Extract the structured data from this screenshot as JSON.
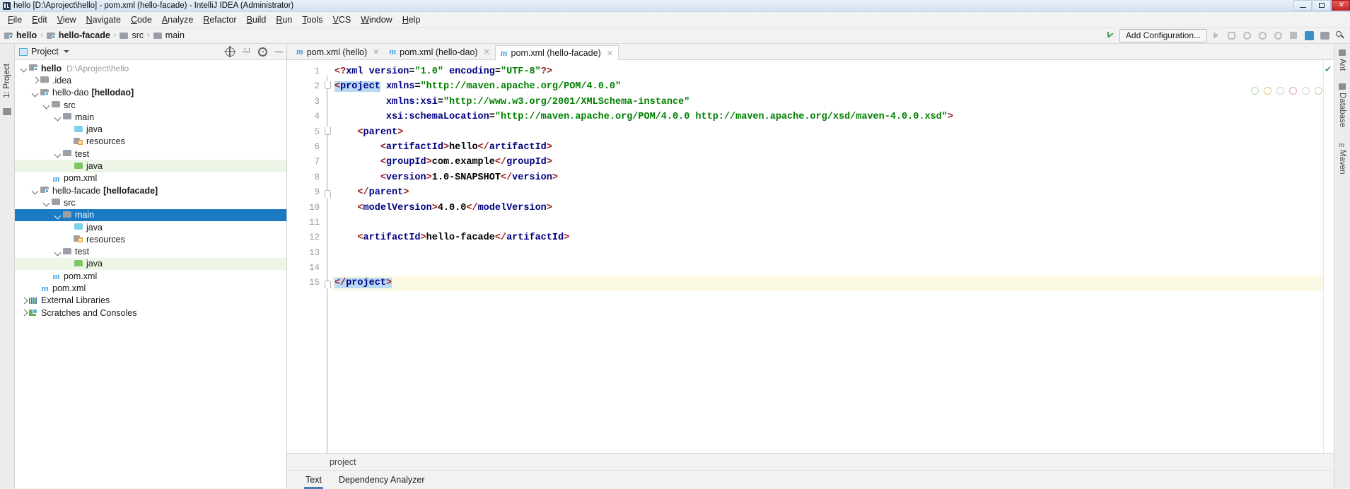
{
  "window": {
    "title": "hello [D:\\Aproject\\hello] - pom.xml (hello-facade) - IntelliJ IDEA (Administrator)",
    "minimize": "–",
    "maximize": "□",
    "close": "✕"
  },
  "menubar": {
    "items": [
      "File",
      "Edit",
      "View",
      "Navigate",
      "Code",
      "Analyze",
      "Refactor",
      "Build",
      "Run",
      "Tools",
      "VCS",
      "Window",
      "Help"
    ]
  },
  "breadcrumb": {
    "separator": "›",
    "items": [
      {
        "label": "hello",
        "icon": "module-icon",
        "bold": true
      },
      {
        "label": "hello-facade",
        "icon": "module-icon",
        "bold": true
      },
      {
        "label": "src",
        "icon": "folder-icon",
        "bold": false
      },
      {
        "label": "main",
        "icon": "folder-icon",
        "bold": false
      }
    ]
  },
  "toolbar": {
    "add_configuration": "Add Configuration...",
    "icons": [
      "back-arrow-icon",
      "run-icon",
      "debug-icon",
      "run-coverage-icon",
      "profile-icon",
      "stop-icon",
      "search-everywhere-icon",
      "layout-icon",
      "settings-icon"
    ]
  },
  "project_panel": {
    "title": "Project",
    "header_icons": [
      "locate-icon",
      "expand-collapse-icon",
      "gear-icon",
      "hide-icon"
    ],
    "left_tab": "1: Project",
    "tree": [
      {
        "indent": 0,
        "arrow": "open",
        "icon": "module-icon",
        "label": "hello",
        "bold": true,
        "sub": "D:\\Aproject\\hello",
        "state": "normal"
      },
      {
        "indent": 1,
        "arrow": "closed",
        "icon": "folder-icon",
        "label": ".idea",
        "bold": false,
        "sub": "",
        "state": "normal"
      },
      {
        "indent": 1,
        "arrow": "open",
        "icon": "module-icon",
        "label": "hello-dao",
        "bold": false,
        "sub": "",
        "bracket": "[hellodao]",
        "state": "normal"
      },
      {
        "indent": 2,
        "arrow": "open",
        "icon": "folder-icon",
        "label": "src",
        "bold": false,
        "sub": "",
        "state": "normal"
      },
      {
        "indent": 3,
        "arrow": "open",
        "icon": "folder-icon",
        "label": "main",
        "bold": false,
        "sub": "",
        "state": "normal"
      },
      {
        "indent": 4,
        "arrow": "none",
        "icon": "source-folder-icon",
        "label": "java",
        "bold": false,
        "sub": "",
        "state": "normal"
      },
      {
        "indent": 4,
        "arrow": "none",
        "icon": "resources-folder-icon",
        "label": "resources",
        "bold": false,
        "sub": "",
        "state": "normal"
      },
      {
        "indent": 3,
        "arrow": "open",
        "icon": "folder-icon",
        "label": "test",
        "bold": false,
        "sub": "",
        "state": "normal"
      },
      {
        "indent": 4,
        "arrow": "none",
        "icon": "test-folder-icon",
        "label": "java",
        "bold": false,
        "sub": "",
        "state": "green"
      },
      {
        "indent": 2,
        "arrow": "none",
        "icon": "maven-icon",
        "label": "pom.xml",
        "bold": false,
        "sub": "",
        "state": "normal"
      },
      {
        "indent": 1,
        "arrow": "open",
        "icon": "module-icon",
        "label": "hello-facade",
        "bold": false,
        "sub": "",
        "bracket": "[hellofacade]",
        "state": "normal"
      },
      {
        "indent": 2,
        "arrow": "open",
        "icon": "folder-icon",
        "label": "src",
        "bold": false,
        "sub": "",
        "state": "normal"
      },
      {
        "indent": 3,
        "arrow": "open",
        "icon": "folder-icon",
        "label": "main",
        "bold": false,
        "sub": "",
        "state": "selected"
      },
      {
        "indent": 4,
        "arrow": "none",
        "icon": "source-folder-icon",
        "label": "java",
        "bold": false,
        "sub": "",
        "state": "normal"
      },
      {
        "indent": 4,
        "arrow": "none",
        "icon": "resources-folder-icon",
        "label": "resources",
        "bold": false,
        "sub": "",
        "state": "normal"
      },
      {
        "indent": 3,
        "arrow": "open",
        "icon": "folder-icon",
        "label": "test",
        "bold": false,
        "sub": "",
        "state": "normal"
      },
      {
        "indent": 4,
        "arrow": "none",
        "icon": "test-folder-icon",
        "label": "java",
        "bold": false,
        "sub": "",
        "state": "green"
      },
      {
        "indent": 2,
        "arrow": "none",
        "icon": "maven-icon",
        "label": "pom.xml",
        "bold": false,
        "sub": "",
        "state": "normal"
      },
      {
        "indent": 1,
        "arrow": "none",
        "icon": "maven-icon",
        "label": "pom.xml",
        "bold": false,
        "sub": "",
        "state": "normal"
      },
      {
        "indent": 0,
        "arrow": "closed",
        "icon": "external-libraries-icon",
        "label": "External Libraries",
        "bold": false,
        "sub": "",
        "state": "normal"
      },
      {
        "indent": 0,
        "arrow": "closed",
        "icon": "scratches-icon",
        "label": "Scratches and Consoles",
        "bold": false,
        "sub": "",
        "state": "normal"
      }
    ]
  },
  "editor": {
    "tabs": [
      {
        "label": "pom.xml (hello)",
        "active": false,
        "close": "✕"
      },
      {
        "label": "pom.xml (hello-dao)",
        "active": false,
        "close": "✕"
      },
      {
        "label": "pom.xml (hello-facade)",
        "active": true,
        "close": "✕"
      }
    ],
    "lines": [
      {
        "n": "1",
        "fold": "none",
        "marker": "",
        "highlight": false,
        "segments": [
          {
            "t": "<?",
            "c": "pi"
          },
          {
            "t": "xml",
            "c": "tag"
          },
          {
            "t": " ",
            "c": "txt"
          },
          {
            "t": "version",
            "c": "attr"
          },
          {
            "t": "=",
            "c": "txt"
          },
          {
            "t": "\"1.0\"",
            "c": "val"
          },
          {
            "t": " ",
            "c": "txt"
          },
          {
            "t": "encoding",
            "c": "attr"
          },
          {
            "t": "=",
            "c": "txt"
          },
          {
            "t": "\"UTF-8\"",
            "c": "val"
          },
          {
            "t": "?>",
            "c": "pi"
          }
        ]
      },
      {
        "n": "2",
        "fold": "down",
        "marker": "",
        "highlight": false,
        "segments": [
          {
            "t": "<",
            "c": "ang sel"
          },
          {
            "t": "project",
            "c": "tag sel"
          },
          {
            "t": " ",
            "c": "txt"
          },
          {
            "t": "xmlns",
            "c": "attr"
          },
          {
            "t": "=",
            "c": "txt"
          },
          {
            "t": "\"http://maven.apache.org/POM/4.0.0\"",
            "c": "val"
          }
        ]
      },
      {
        "n": "3",
        "fold": "none",
        "marker": "",
        "highlight": false,
        "segments": [
          {
            "t": "         ",
            "c": "txt"
          },
          {
            "t": "xmlns:xsi",
            "c": "attr"
          },
          {
            "t": "=",
            "c": "txt"
          },
          {
            "t": "\"http://www.w3.org/2001/XMLSchema-instance\"",
            "c": "val"
          }
        ]
      },
      {
        "n": "4",
        "fold": "none",
        "marker": "",
        "highlight": false,
        "segments": [
          {
            "t": "         ",
            "c": "txt"
          },
          {
            "t": "xsi:schemaLocation",
            "c": "attr"
          },
          {
            "t": "=",
            "c": "txt"
          },
          {
            "t": "\"http://maven.apache.org/POM/4.0.0 http://maven.apache.org/xsd/maven-4.0.0.xsd\"",
            "c": "val"
          },
          {
            "t": ">",
            "c": "ang"
          }
        ]
      },
      {
        "n": "5",
        "fold": "down",
        "marker": "m",
        "highlight": false,
        "segments": [
          {
            "t": "    ",
            "c": "txt"
          },
          {
            "t": "<",
            "c": "ang"
          },
          {
            "t": "parent",
            "c": "tag"
          },
          {
            "t": ">",
            "c": "ang"
          }
        ]
      },
      {
        "n": "6",
        "fold": "none",
        "marker": "",
        "highlight": false,
        "segments": [
          {
            "t": "        ",
            "c": "txt"
          },
          {
            "t": "<",
            "c": "ang"
          },
          {
            "t": "artifactId",
            "c": "tag"
          },
          {
            "t": ">",
            "c": "ang"
          },
          {
            "t": "hello",
            "c": "txt"
          },
          {
            "t": "</",
            "c": "ang"
          },
          {
            "t": "artifactId",
            "c": "tag"
          },
          {
            "t": ">",
            "c": "ang"
          }
        ]
      },
      {
        "n": "7",
        "fold": "none",
        "marker": "",
        "highlight": false,
        "segments": [
          {
            "t": "        ",
            "c": "txt"
          },
          {
            "t": "<",
            "c": "ang"
          },
          {
            "t": "groupId",
            "c": "tag"
          },
          {
            "t": ">",
            "c": "ang"
          },
          {
            "t": "com.example",
            "c": "txt"
          },
          {
            "t": "</",
            "c": "ang"
          },
          {
            "t": "groupId",
            "c": "tag"
          },
          {
            "t": ">",
            "c": "ang"
          }
        ]
      },
      {
        "n": "8",
        "fold": "none",
        "marker": "",
        "highlight": false,
        "segments": [
          {
            "t": "        ",
            "c": "txt"
          },
          {
            "t": "<",
            "c": "ang"
          },
          {
            "t": "version",
            "c": "tag"
          },
          {
            "t": ">",
            "c": "ang"
          },
          {
            "t": "1.0-SNAPSHOT",
            "c": "txt"
          },
          {
            "t": "</",
            "c": "ang"
          },
          {
            "t": "version",
            "c": "tag"
          },
          {
            "t": ">",
            "c": "ang"
          }
        ]
      },
      {
        "n": "9",
        "fold": "up",
        "marker": "",
        "highlight": false,
        "segments": [
          {
            "t": "    ",
            "c": "txt"
          },
          {
            "t": "</",
            "c": "ang"
          },
          {
            "t": "parent",
            "c": "tag"
          },
          {
            "t": ">",
            "c": "ang"
          }
        ]
      },
      {
        "n": "10",
        "fold": "none",
        "marker": "",
        "highlight": false,
        "segments": [
          {
            "t": "    ",
            "c": "txt"
          },
          {
            "t": "<",
            "c": "ang"
          },
          {
            "t": "modelVersion",
            "c": "tag"
          },
          {
            "t": ">",
            "c": "ang"
          },
          {
            "t": "4.0.0",
            "c": "txt"
          },
          {
            "t": "</",
            "c": "ang"
          },
          {
            "t": "modelVersion",
            "c": "tag"
          },
          {
            "t": ">",
            "c": "ang"
          }
        ]
      },
      {
        "n": "11",
        "fold": "none",
        "marker": "",
        "highlight": false,
        "segments": []
      },
      {
        "n": "12",
        "fold": "none",
        "marker": "",
        "highlight": false,
        "segments": [
          {
            "t": "    ",
            "c": "txt"
          },
          {
            "t": "<",
            "c": "ang"
          },
          {
            "t": "artifactId",
            "c": "tag"
          },
          {
            "t": ">",
            "c": "ang"
          },
          {
            "t": "hello-facade",
            "c": "txt"
          },
          {
            "t": "</",
            "c": "ang"
          },
          {
            "t": "artifactId",
            "c": "tag"
          },
          {
            "t": ">",
            "c": "ang"
          }
        ]
      },
      {
        "n": "13",
        "fold": "none",
        "marker": "",
        "highlight": false,
        "segments": []
      },
      {
        "n": "14",
        "fold": "none",
        "marker": "",
        "highlight": false,
        "segments": []
      },
      {
        "n": "15",
        "fold": "up",
        "marker": "",
        "highlight": true,
        "segments": [
          {
            "t": "</",
            "c": "ang sel"
          },
          {
            "t": "project",
            "c": "tag sel"
          },
          {
            "t": ">",
            "c": "ang sel"
          }
        ]
      }
    ],
    "breadcrumb_hint": "project",
    "bottom_tabs": [
      {
        "label": "Text",
        "active": true
      },
      {
        "label": "Dependency Analyzer",
        "active": false
      }
    ]
  },
  "right_tabs": [
    {
      "label": "Ant",
      "icon": "ant-icon"
    },
    {
      "label": "Database",
      "icon": "database-icon"
    },
    {
      "label": "Maven",
      "icon": "maven-icon"
    }
  ],
  "colors": {
    "selection_blue": "#1a7bc4",
    "test_green_row": "#edf6e6",
    "caret_line": "#fbf8e4",
    "tag": "#000080",
    "value": "#008000",
    "angle": "#9a2020"
  }
}
